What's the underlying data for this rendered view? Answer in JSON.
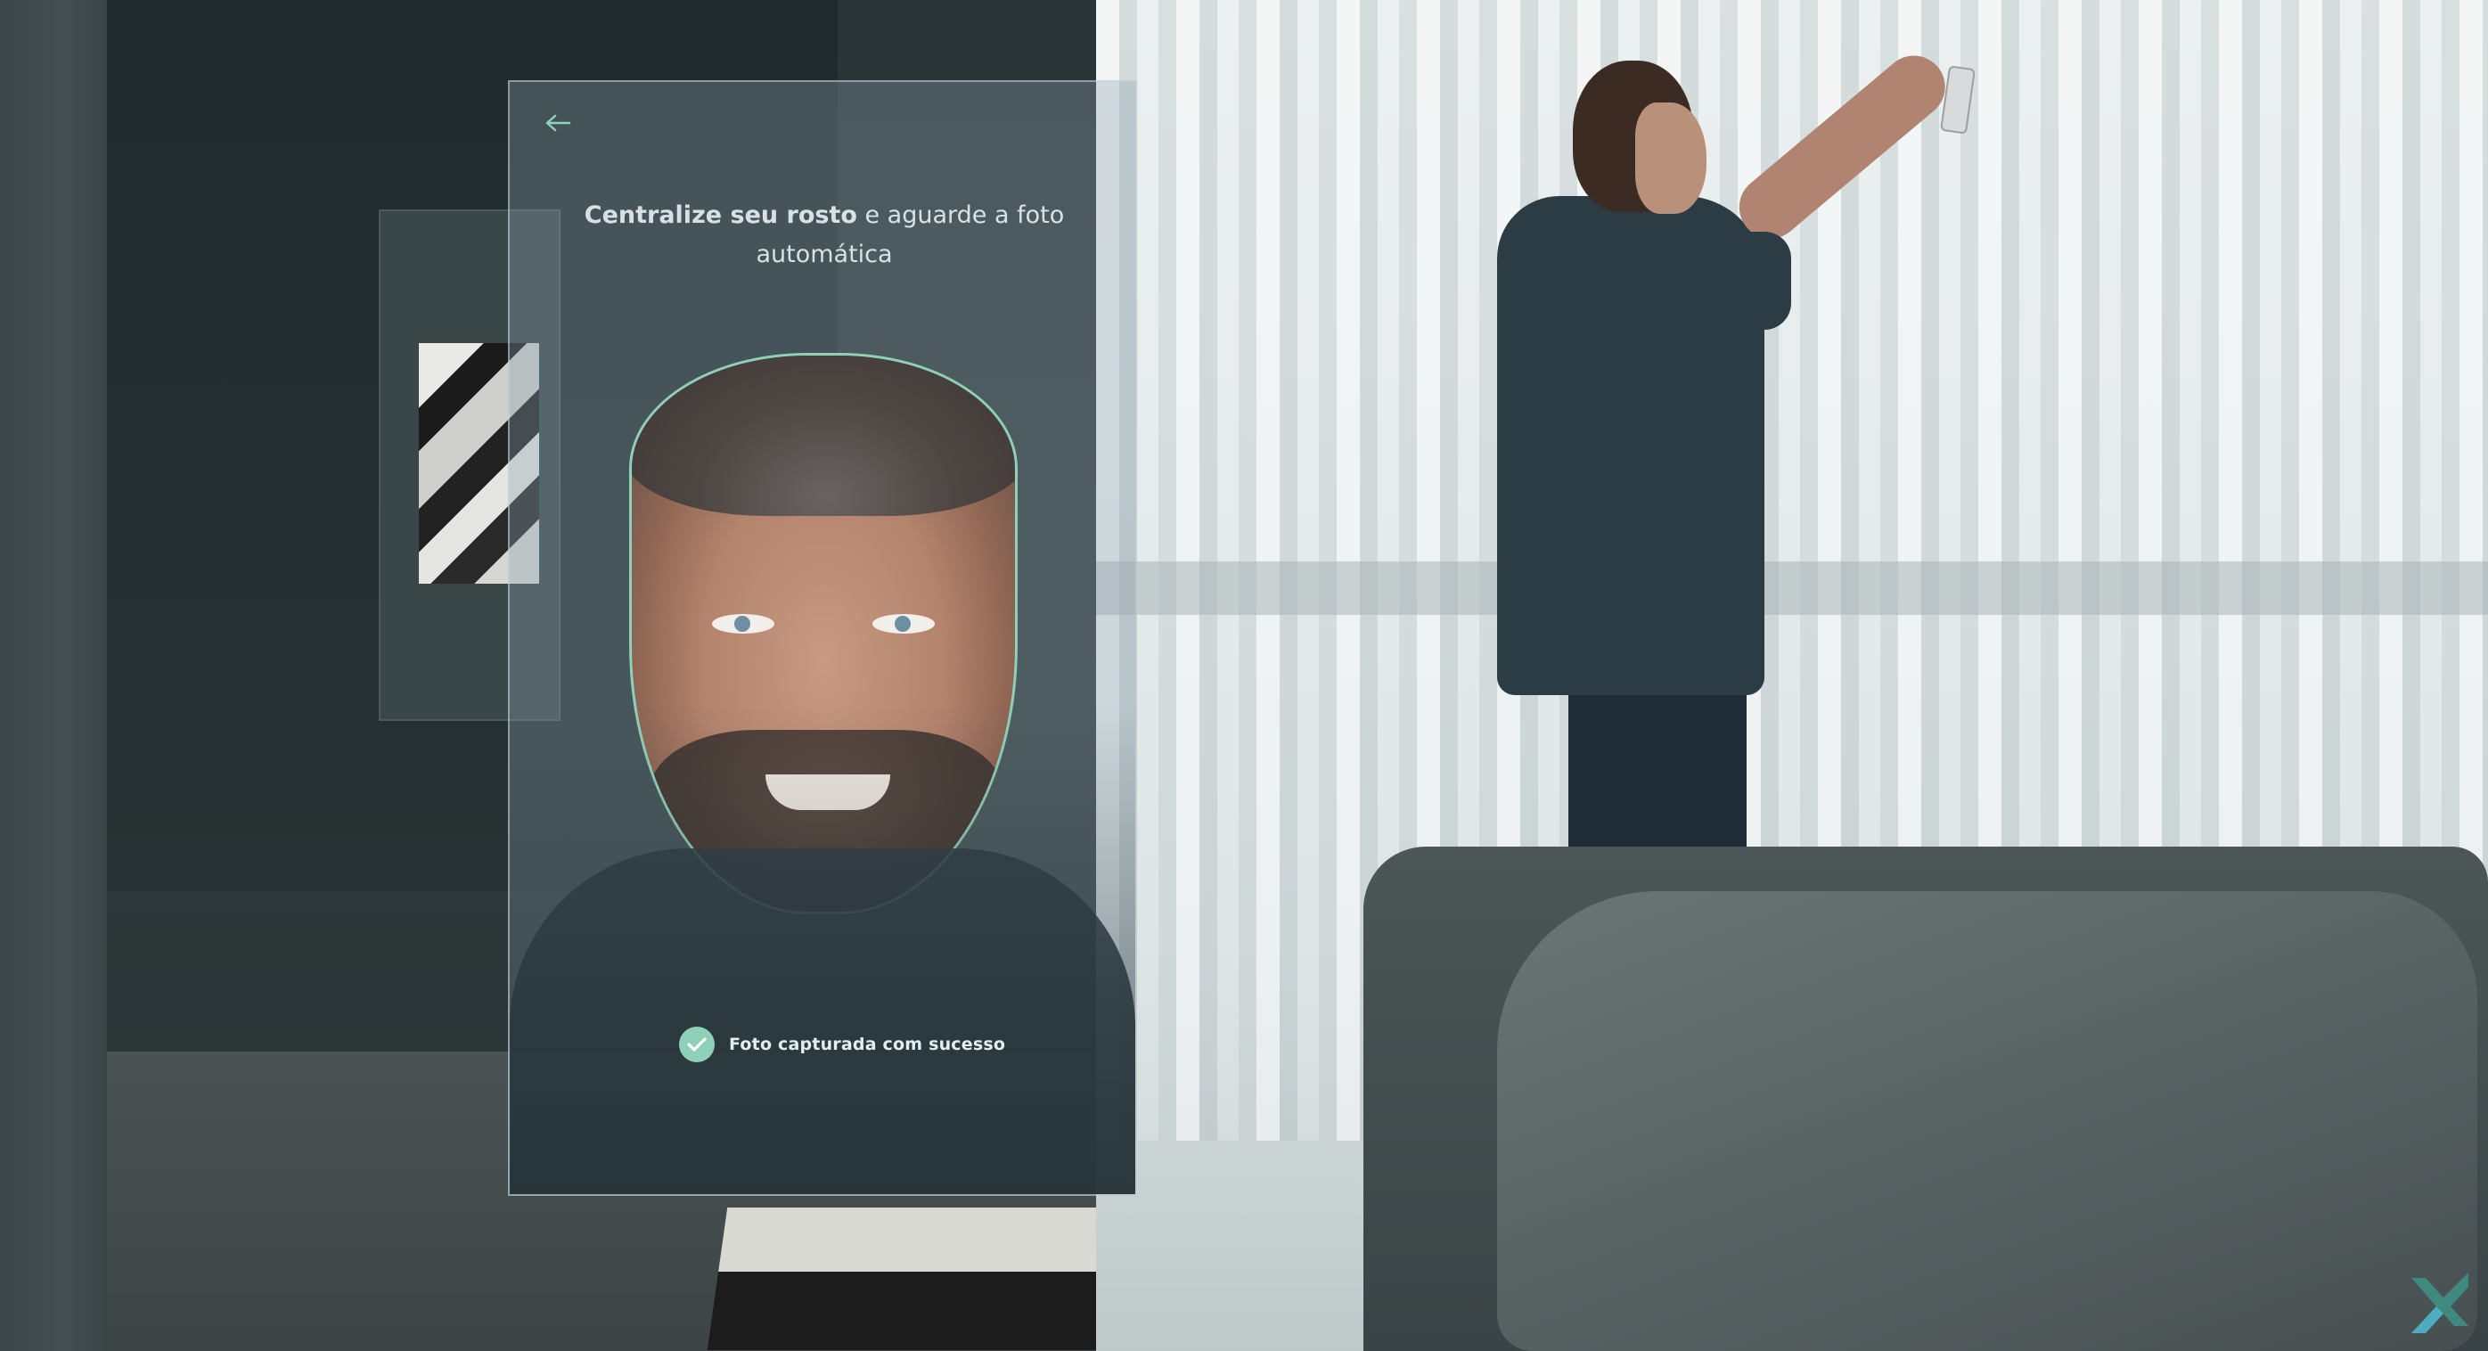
{
  "panel": {
    "back_icon": "arrow-left-icon",
    "instruction_bold": "Centralize seu rosto",
    "instruction_rest": " e aguarde a foto automática",
    "status_text": "Foto capturada com sucesso",
    "status_icon": "check-circle-icon"
  },
  "colors": {
    "accent": "#8fd0b8",
    "panel_text": "#e4eef0"
  }
}
